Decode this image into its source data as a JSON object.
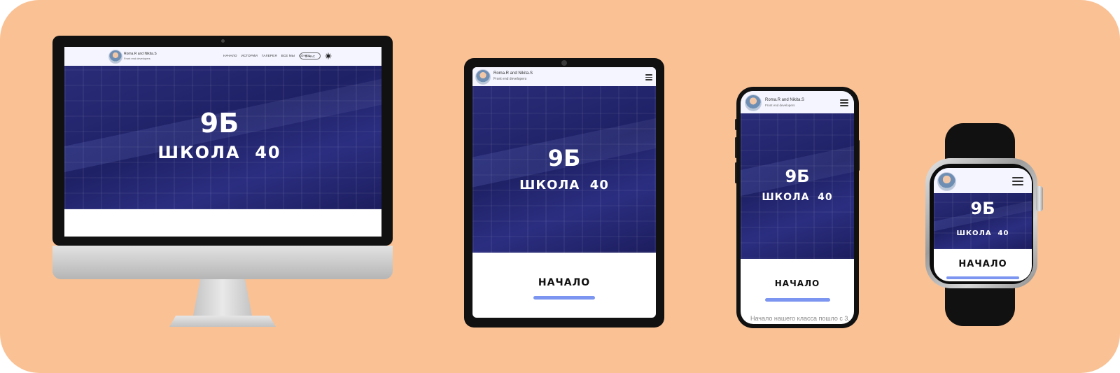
{
  "brand": {
    "name": "Roma.R and Nikita.S",
    "role": "Front end developers"
  },
  "nav": {
    "items": [
      "НАЧАЛО",
      "ИСТОРИИ",
      "ГАЛЕРЕЯ",
      "ВСЕ МЫ",
      "КОНЕЦ"
    ],
    "about_label": "О НАС"
  },
  "hero": {
    "title": "9Б",
    "subtitle": "ШКОЛА  40"
  },
  "section": {
    "start_label": "НАЧАЛО"
  },
  "phone": {
    "paragraph_preview": "Начало нашего класса пошло с 3..."
  },
  "colors": {
    "background": "#f9c194",
    "hero": "#23256e",
    "accent": "#7b95f0",
    "header": "#f4f5ff"
  },
  "icons": {
    "theme_toggle": "sun-moon-icon",
    "menu": "hamburger-menu-icon",
    "avatar": "avatar-photo"
  }
}
